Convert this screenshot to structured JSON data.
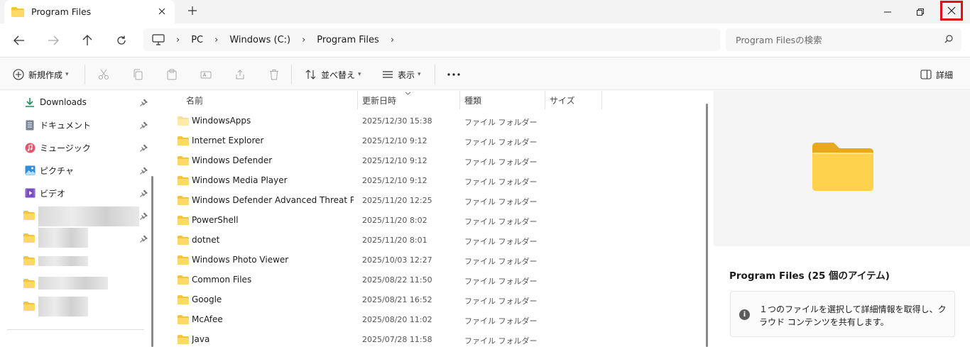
{
  "tab": {
    "title": "Program Files"
  },
  "address": {
    "crumbs": [
      "PC",
      "Windows (C:)",
      "Program Files"
    ],
    "search_placeholder": "Program Filesの検索"
  },
  "commands": {
    "new": "新規作成",
    "sort": "並べ替え",
    "view": "表示",
    "details": "詳細"
  },
  "nav": {
    "items": [
      {
        "label": "Downloads",
        "icon": "download-icon"
      },
      {
        "label": "ドキュメント",
        "icon": "document-icon"
      },
      {
        "label": "ミュージック",
        "icon": "music-icon"
      },
      {
        "label": "ピクチャ",
        "icon": "picture-icon"
      },
      {
        "label": "ビデオ",
        "icon": "video-icon"
      }
    ]
  },
  "columns": {
    "name": "名前",
    "date": "更新日時",
    "type": "種類",
    "size": "サイズ"
  },
  "files": [
    {
      "name": "WindowsApps",
      "date": "2025/12/30 15:38",
      "type": "ファイル フォルダー"
    },
    {
      "name": "Internet Explorer",
      "date": "2025/12/10 9:12",
      "type": "ファイル フォルダー"
    },
    {
      "name": "Windows Defender",
      "date": "2025/12/10 9:12",
      "type": "ファイル フォルダー"
    },
    {
      "name": "Windows Media Player",
      "date": "2025/12/10 9:12",
      "type": "ファイル フォルダー"
    },
    {
      "name": "Windows Defender Advanced Threat Prot...",
      "date": "2025/11/20 12:25",
      "type": "ファイル フォルダー"
    },
    {
      "name": "PowerShell",
      "date": "2025/11/20 8:02",
      "type": "ファイル フォルダー"
    },
    {
      "name": "dotnet",
      "date": "2025/11/20 8:01",
      "type": "ファイル フォルダー"
    },
    {
      "name": "Windows Photo Viewer",
      "date": "2025/10/03 12:27",
      "type": "ファイル フォルダー"
    },
    {
      "name": "Common Files",
      "date": "2025/08/22 11:50",
      "type": "ファイル フォルダー"
    },
    {
      "name": "Google",
      "date": "2025/08/21 16:52",
      "type": "ファイル フォルダー"
    },
    {
      "name": "McAfee",
      "date": "2025/08/20 11:02",
      "type": "ファイル フォルダー"
    },
    {
      "name": "Java",
      "date": "2025/07/28 11:58",
      "type": "ファイル フォルダー"
    }
  ],
  "details": {
    "title": "Program Files (25 個のアイテム)",
    "info": "１つのファイルを選択して詳細情報を取得し、クラウド コンテンツを共有します。"
  },
  "colors": {
    "folder": "#f5c33b",
    "folder_light": "#ffd966",
    "close_highlight": "#e0101a"
  }
}
